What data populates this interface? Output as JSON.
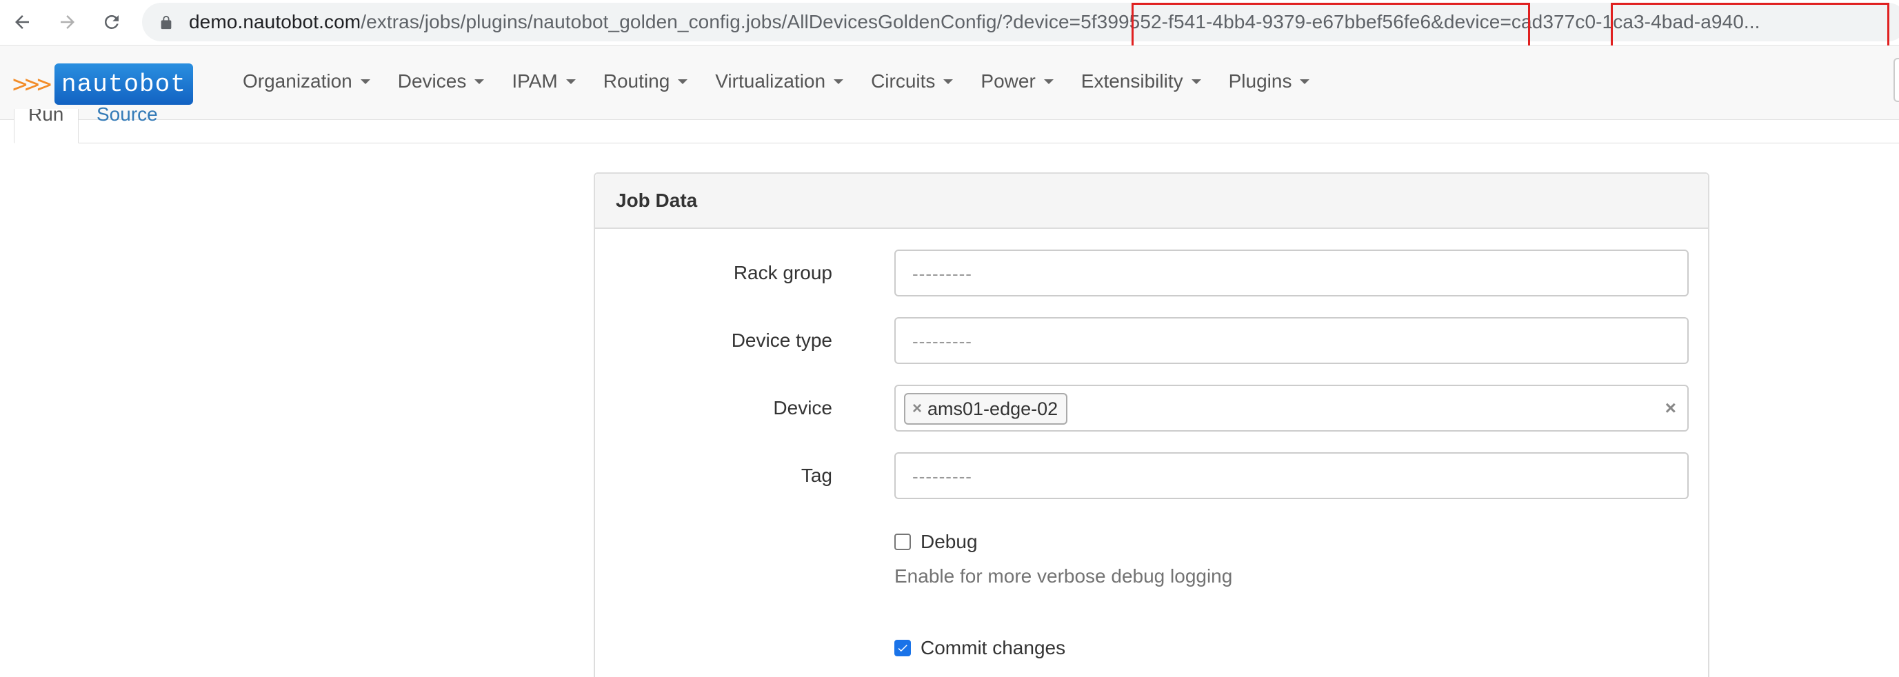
{
  "browser": {
    "url_host": "demo.nautobot.com",
    "url_rest": "/extras/jobs/plugins/nautobot_golden_config.jobs/AllDevicesGoldenConfig/?device=5f399552-f541-4bb4-9379-e67bbef56fe6&device=cad377c0-1ca3-4bad-a940..."
  },
  "brand": {
    "chevrons": ">>>",
    "name": "nautobot"
  },
  "navbar": {
    "items": [
      {
        "label": "Organization"
      },
      {
        "label": "Devices"
      },
      {
        "label": "IPAM"
      },
      {
        "label": "Routing"
      },
      {
        "label": "Virtualization"
      },
      {
        "label": "Circuits"
      },
      {
        "label": "Power"
      },
      {
        "label": "Extensibility"
      },
      {
        "label": "Plugins"
      }
    ]
  },
  "tabs": {
    "run": "Run",
    "source": "Source"
  },
  "panel": {
    "title": "Job Data",
    "fields": {
      "rack_group": {
        "label": "Rack group",
        "placeholder": "---------"
      },
      "device_type": {
        "label": "Device type",
        "placeholder": "---------"
      },
      "device": {
        "label": "Device",
        "selected": "ams01-edge-02",
        "chip_remove": "×",
        "clear": "×"
      },
      "tag": {
        "label": "Tag",
        "placeholder": "---------"
      }
    },
    "debug": {
      "label": "Debug",
      "checked": false,
      "help": "Enable for more verbose debug logging"
    },
    "commit": {
      "label": "Commit changes",
      "checked": true
    }
  },
  "colors": {
    "highlight": "#e02020",
    "brand_orange": "#f28c28",
    "brand_blue": "#1a73e8",
    "link": "#337ab7"
  }
}
